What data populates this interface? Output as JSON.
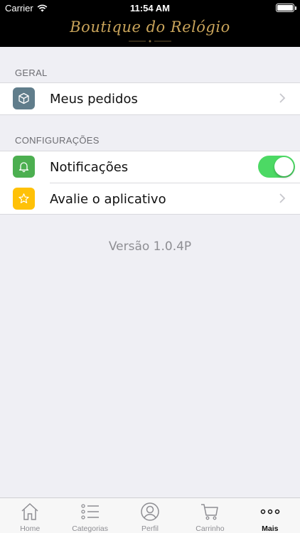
{
  "status_bar": {
    "carrier": "Carrier",
    "time": "11:54 AM"
  },
  "header": {
    "logo_text": "Boutique do Relógio",
    "logo_color": "#c9a45a"
  },
  "sections": [
    {
      "title": "GERAL",
      "rows": [
        {
          "icon": "package-icon",
          "icon_color": "#607d8b",
          "label": "Meus pedidos",
          "accessory": "chevron"
        }
      ]
    },
    {
      "title": "CONFIGURAÇÕES",
      "rows": [
        {
          "icon": "bell-icon",
          "icon_color": "#4caf50",
          "label": "Notificações",
          "accessory": "toggle",
          "toggle_on": true
        },
        {
          "icon": "star-icon",
          "icon_color": "#ffc107",
          "label": "Avalie o aplicativo",
          "accessory": "chevron"
        }
      ]
    }
  ],
  "version": "Versão 1.0.4P",
  "tabbar": {
    "active": "Mais",
    "tabs": [
      {
        "icon": "home-icon",
        "label": "Home"
      },
      {
        "icon": "list-icon",
        "label": "Categorias"
      },
      {
        "icon": "user-icon",
        "label": "Perfil"
      },
      {
        "icon": "cart-icon",
        "label": "Carrinho"
      },
      {
        "icon": "more-icon",
        "label": "Mais"
      }
    ]
  },
  "colors": {
    "toggle_on": "#4cd964",
    "background": "#efeff4"
  }
}
